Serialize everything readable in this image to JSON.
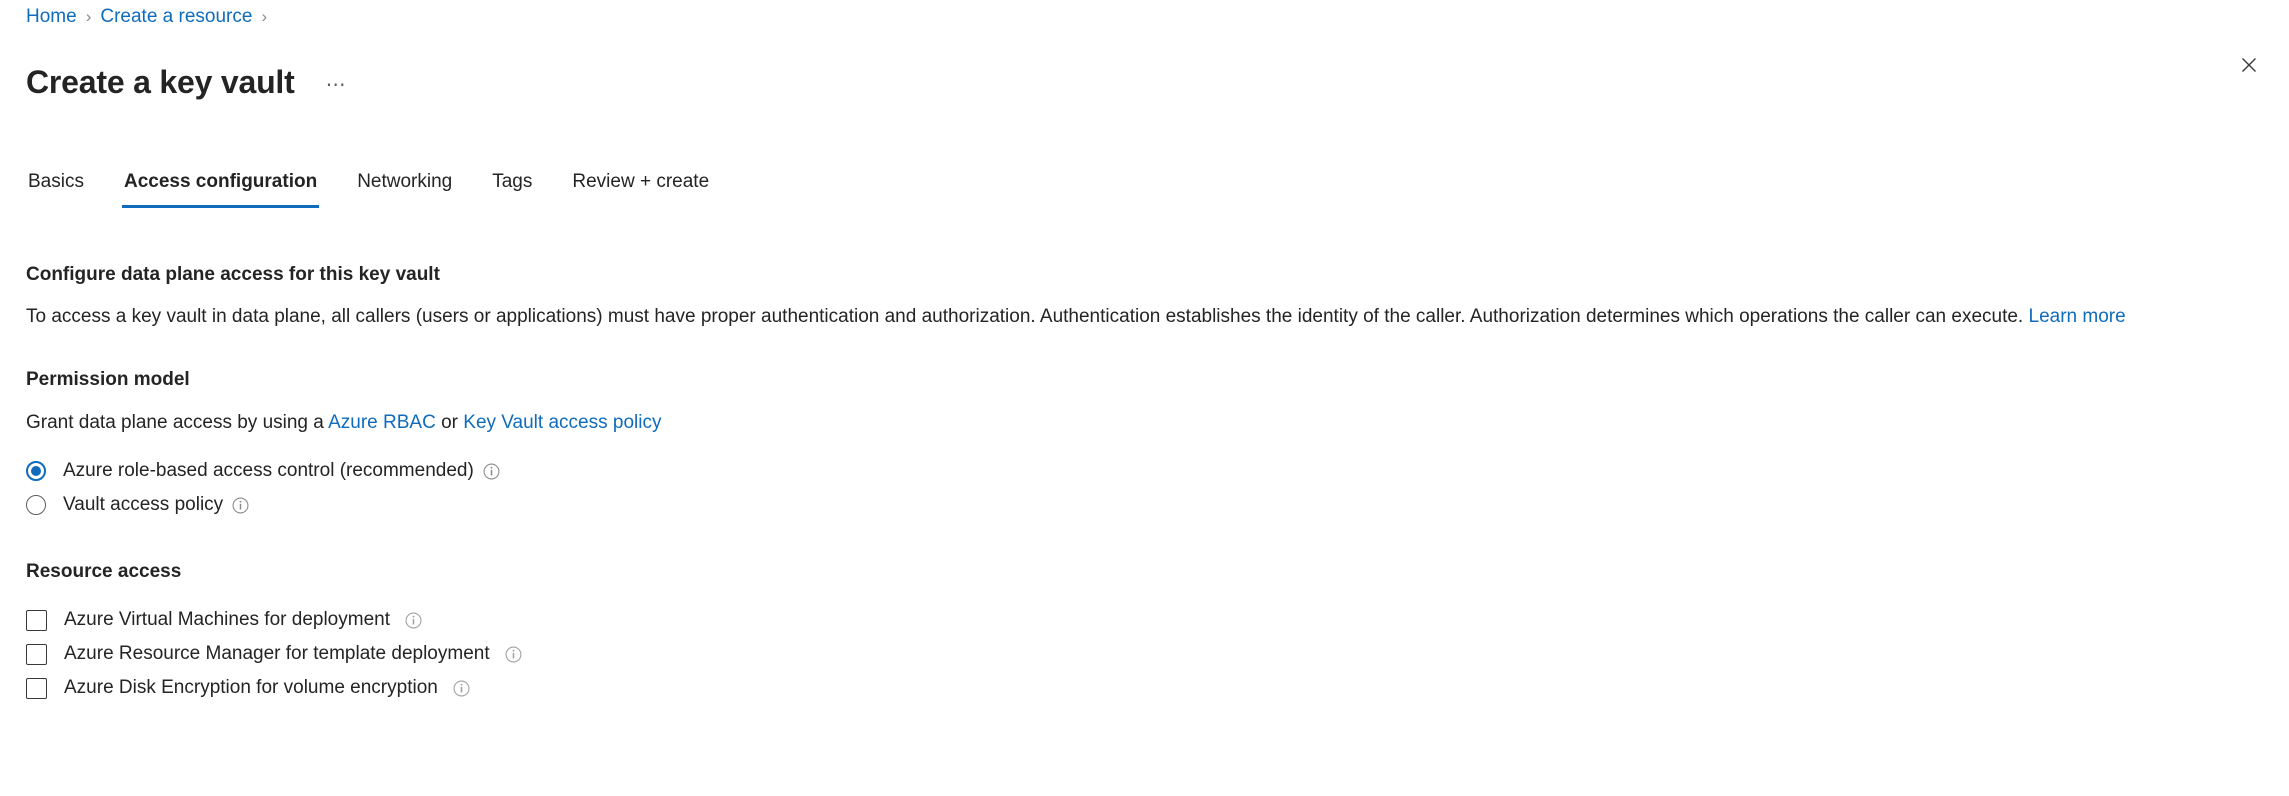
{
  "breadcrumb": {
    "items": [
      {
        "label": "Home"
      },
      {
        "label": "Create a resource"
      }
    ],
    "separator": "›"
  },
  "header": {
    "title": "Create a key vault",
    "more_actions_label": "⋯",
    "close_icon": "close-icon"
  },
  "tabs": [
    {
      "label": "Basics",
      "active": false
    },
    {
      "label": "Access configuration",
      "active": true
    },
    {
      "label": "Networking",
      "active": false
    },
    {
      "label": "Tags",
      "active": false
    },
    {
      "label": "Review + create",
      "active": false
    }
  ],
  "main": {
    "configure_section": {
      "heading": "Configure data plane access for this key vault",
      "description_text": "To access a key vault in data plane, all callers (users or applications) must have proper authentication and authorization. Authentication establishes the identity of the caller. Authorization determines which operations the caller can execute.",
      "learn_more_label": "Learn more"
    },
    "permission_model": {
      "heading": "Permission model",
      "grant_prefix": "Grant data plane access by using a",
      "link_rbac": "Azure RBAC",
      "or_text": "or",
      "link_access_policy": "Key Vault access policy",
      "options": [
        {
          "label": "Azure role-based access control (recommended)",
          "selected": true,
          "info": "info-icon"
        },
        {
          "label": "Vault access policy",
          "selected": false,
          "info": "info-icon"
        }
      ]
    },
    "resource_access": {
      "heading": "Resource access",
      "checkboxes": [
        {
          "label": "Azure Virtual Machines for deployment",
          "checked": false,
          "info": "info-icon"
        },
        {
          "label": "Azure Resource Manager for template deployment",
          "checked": false,
          "info": "info-icon"
        },
        {
          "label": "Azure Disk Encryption for volume encryption",
          "checked": false,
          "info": "info-icon"
        }
      ]
    }
  },
  "colors": {
    "accent": "#0f6cbd",
    "link": "#0f6cbd",
    "text": "#242424",
    "border": "#605e5c",
    "background": "#ffffff"
  }
}
